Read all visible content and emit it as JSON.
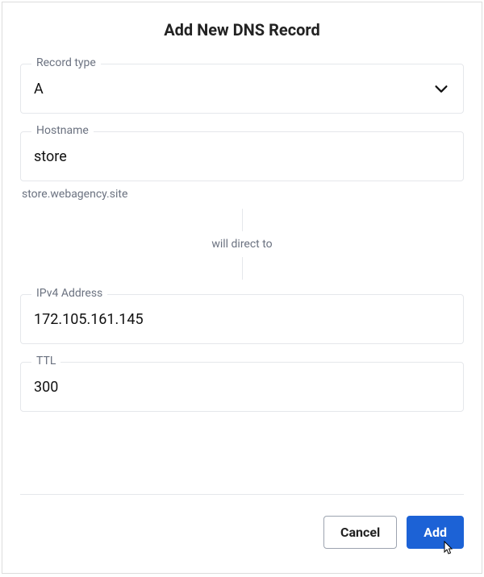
{
  "title": "Add New DNS Record",
  "fields": {
    "recordType": {
      "label": "Record type",
      "value": "A"
    },
    "hostname": {
      "label": "Hostname",
      "value": "store",
      "helper": "store.webagency.site"
    },
    "divider": "will direct to",
    "ipv4": {
      "label": "IPv4 Address",
      "value": "172.105.161.145"
    },
    "ttl": {
      "label": "TTL",
      "value": "300"
    }
  },
  "buttons": {
    "cancel": "Cancel",
    "add": "Add"
  }
}
